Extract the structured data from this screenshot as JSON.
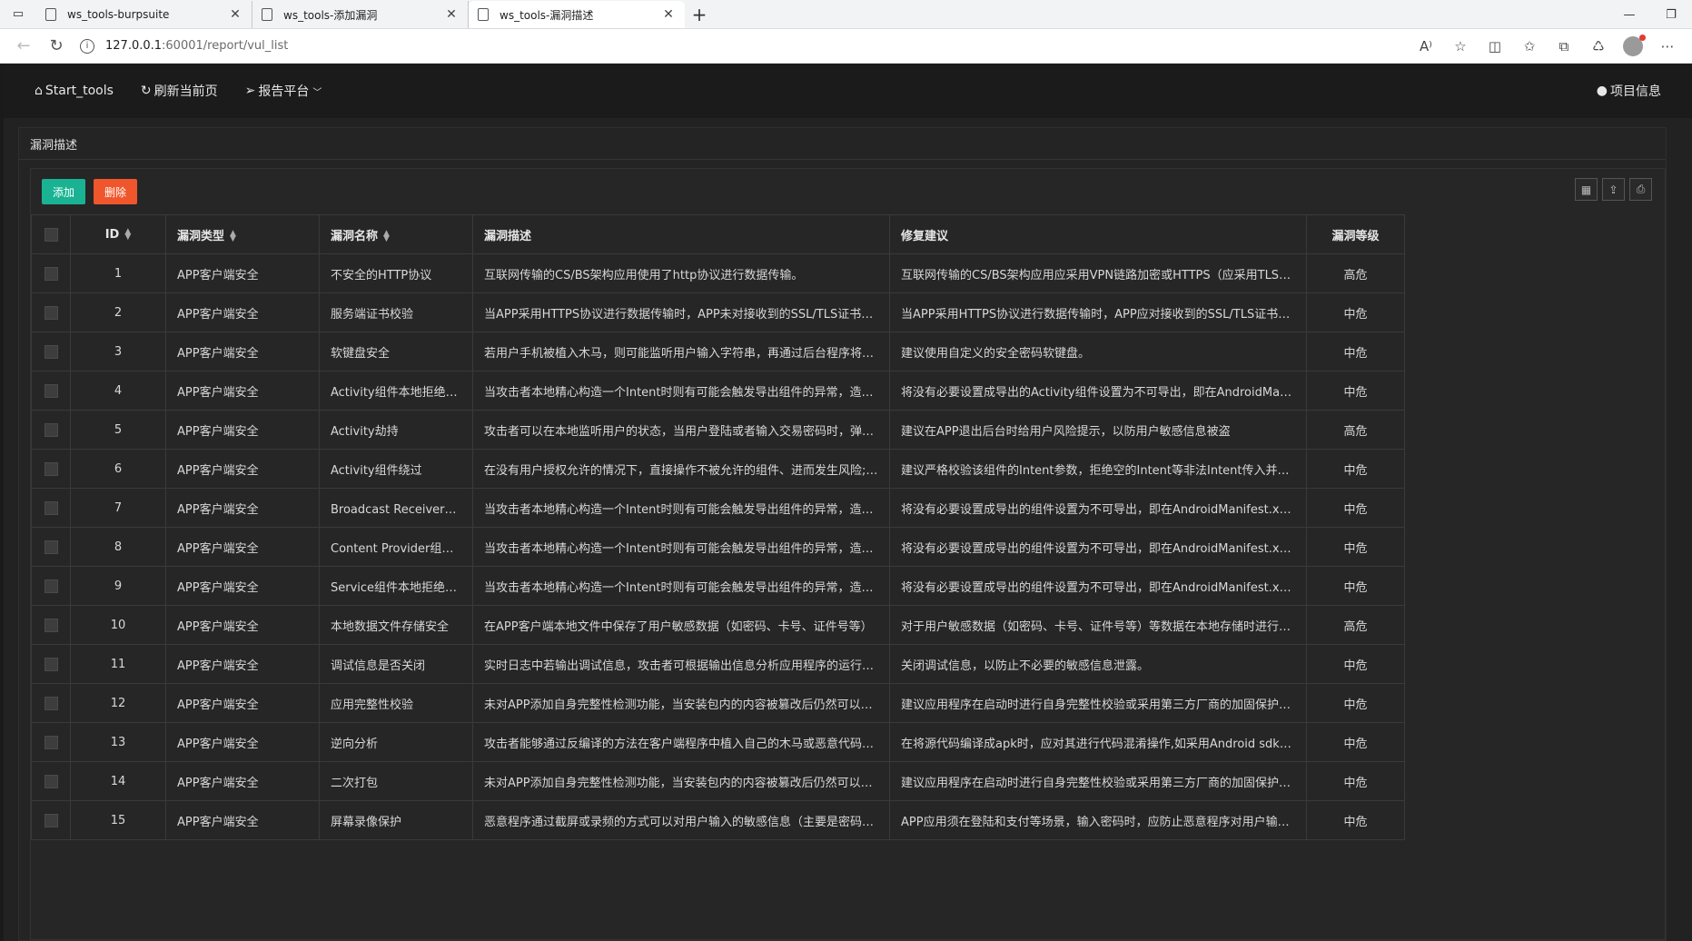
{
  "browser": {
    "tabs": [
      {
        "title": "ws_tools-burpsuite"
      },
      {
        "title": "ws_tools-添加漏洞"
      },
      {
        "title": "ws_tools-漏洞描述"
      }
    ],
    "url_host": "127.0.0.1",
    "url_path": ":60001/report/vul_list"
  },
  "nav": {
    "start": "Start_tools",
    "refresh": "刷新当前页",
    "report": "报告平台",
    "project_info": "项目信息"
  },
  "panel": {
    "title": "漏洞描述",
    "add_label": "添加",
    "delete_label": "删除"
  },
  "colors": {
    "add": "#19b394",
    "delete": "#f0562b"
  },
  "table": {
    "headers": {
      "id": "ID",
      "type": "漏洞类型",
      "name": "漏洞名称",
      "desc": "漏洞描述",
      "fix": "修复建议",
      "level": "漏洞等级"
    },
    "rows": [
      {
        "id": "1",
        "type": "APP客户端安全",
        "name": "不安全的HTTP协议",
        "desc": "互联网传输的CS/BS架构应用使用了http协议进行数据传输。",
        "fix": "互联网传输的CS/BS架构应用应采用VPN链路加密或HTTPS（应采用TLS加密）...",
        "level": "高危"
      },
      {
        "id": "2",
        "type": "APP客户端安全",
        "name": "服务端证书校验",
        "desc": "当APP采用HTTPS协议进行数据传输时，APP未对接收到的SSL/TLS证书进行合...",
        "fix": "当APP采用HTTPS协议进行数据传输时，APP应对接收到的SSL/TLS证书进行合...",
        "level": "中危"
      },
      {
        "id": "3",
        "type": "APP客户端安全",
        "name": "软键盘安全",
        "desc": "若用户手机被植入木马，则可能监听用户输入字符串，再通过后台程序将用户输...",
        "fix": "建议使用自定义的安全密码软键盘。",
        "level": "中危"
      },
      {
        "id": "4",
        "type": "APP客户端安全",
        "name": "Activity组件本地拒绝服务",
        "desc": "当攻击者本地精心构造一个Intent时则有可能会触发导出组件的异常，造成本地拒...",
        "fix": "将没有必要设置成导出的Activity组件设置为不可导出，即在AndroidManifest.xml...",
        "level": "中危"
      },
      {
        "id": "5",
        "type": "APP客户端安全",
        "name": "Activity劫持",
        "desc": "攻击者可以在本地监听用户的状态，当用户登陆或者输入交易密码时，弹出伪造...",
        "fix": "建议在APP退出后台时给用户风险提示，以防用户敏感信息被盗",
        "level": "高危"
      },
      {
        "id": "6",
        "type": "APP客户端安全",
        "name": "Activity组件绕过",
        "desc": "在没有用户授权允许的情况下，直接操作不被允许的组件、进而发生风险;例如,直...",
        "fix": "建议严格校验该组件的Intent参数，拒绝空的Intent等非法Intent传入并打开该组件。",
        "level": "中危"
      },
      {
        "id": "7",
        "type": "APP客户端安全",
        "name": "Broadcast Receiver组件...",
        "desc": "当攻击者本地精心构造一个Intent时则有可能会触发导出组件的异常，造成本地拒...",
        "fix": "将没有必要设置成导出的组件设置为不可导出，即在AndroidManifest.xml文件中...",
        "level": "中危"
      },
      {
        "id": "8",
        "type": "APP客户端安全",
        "name": "Content Provider组件本...",
        "desc": "当攻击者本地精心构造一个Intent时则有可能会触发导出组件的异常，造成本地拒...",
        "fix": "将没有必要设置成导出的组件设置为不可导出，即在AndroidManifest.xml文件中...",
        "level": "中危"
      },
      {
        "id": "9",
        "type": "APP客户端安全",
        "name": "Service组件本地拒绝服务",
        "desc": "当攻击者本地精心构造一个Intent时则有可能会触发导出组件的异常，造成本地拒...",
        "fix": "将没有必要设置成导出的组件设置为不可导出，即在AndroidManifest.xml文件中...",
        "level": "中危"
      },
      {
        "id": "10",
        "type": "APP客户端安全",
        "name": "本地数据文件存储安全",
        "desc": "在APP客户端本地文件中保存了用户敏感数据（如密码、卡号、证件号等）",
        "fix": "对于用户敏感数据（如密码、卡号、证件号等）等数据在本地存储时进行加密。",
        "level": "高危"
      },
      {
        "id": "11",
        "type": "APP客户端安全",
        "name": "调试信息是否关闭",
        "desc": "实时日志中若输出调试信息，攻击者可根据输出信息分析应用程序的运行逻辑，...",
        "fix": "关闭调试信息，以防止不必要的敏感信息泄露。",
        "level": "中危"
      },
      {
        "id": "12",
        "type": "APP客户端安全",
        "name": "应用完整性校验",
        "desc": "未对APP添加自身完整性检测功能，当安装包内的内容被篡改后仍然可以正常安...",
        "fix": "建议应用程序在启动时进行自身完整性校验或采用第三方厂商的加固保护产品进...",
        "level": "中危"
      },
      {
        "id": "13",
        "type": "APP客户端安全",
        "name": "逆向分析",
        "desc": "攻击者能够通过反编译的方法在客户端程序中植入自己的木马或恶意代码以及植...",
        "fix": "在将源代码编译成apk时，应对其进行代码混淆操作,如采用Android sdk自带的pro...",
        "level": "中危"
      },
      {
        "id": "14",
        "type": "APP客户端安全",
        "name": "二次打包",
        "desc": "未对APP添加自身完整性检测功能，当安装包内的内容被篡改后仍然可以二次打...",
        "fix": "建议应用程序在启动时进行自身完整性校验或采用第三方厂商的加固保护产品进...",
        "level": "中危"
      },
      {
        "id": "15",
        "type": "APP客户端安全",
        "name": "屏幕录像保护",
        "desc": "恶意程序通过截屏或录频的方式可以对用户输入的敏感信息（主要是密码）进行...",
        "fix": "APP应用须在登陆和支付等场景，输入密码时，应防止恶意程序对用户输入的敏...",
        "level": "中危"
      }
    ]
  }
}
